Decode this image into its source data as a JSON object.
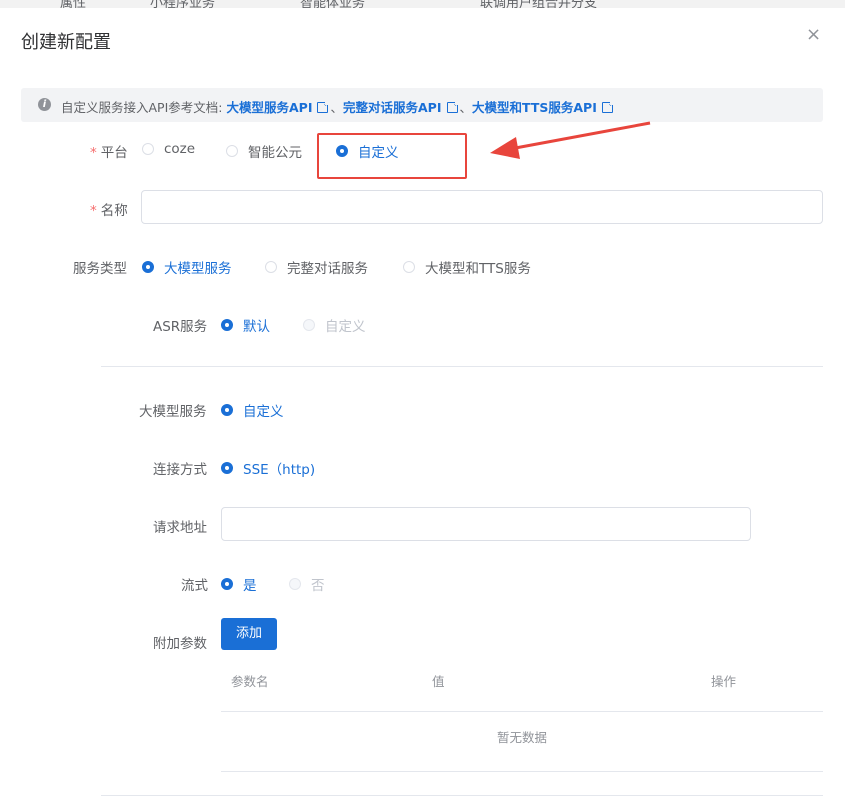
{
  "background_tabs": [
    "属性",
    "小程序业务",
    "智能体业务",
    "联调用户组合并分支"
  ],
  "dialog": {
    "title": "创建新配置",
    "close": "×"
  },
  "tip": {
    "text": "自定义服务接入API参考文档:",
    "links": [
      "大模型服务API",
      "完整对话服务API",
      "大模型和TTS服务API"
    ],
    "sep": "、"
  },
  "form": {
    "platform": {
      "label": "平台",
      "options": [
        "coze",
        "智能公元",
        "自定义"
      ],
      "selected": "自定义"
    },
    "name": {
      "label": "名称",
      "value": ""
    },
    "service_type": {
      "label": "服务类型",
      "options": [
        "大模型服务",
        "完整对话服务",
        "大模型和TTS服务"
      ],
      "selected": "大模型服务"
    },
    "asr": {
      "label": "ASR服务",
      "options": [
        "默认",
        "自定义"
      ],
      "selected": "默认"
    },
    "llm": {
      "label": "大模型服务",
      "options": [
        "自定义"
      ],
      "selected": "自定义"
    },
    "connection": {
      "label": "连接方式",
      "options": [
        "SSE（http)"
      ],
      "selected": "SSE（http)"
    },
    "url": {
      "label": "请求地址",
      "value": ""
    },
    "stream": {
      "label": "流式",
      "options": [
        "是",
        "否"
      ],
      "selected": "是"
    },
    "params": {
      "label": "附加参数",
      "add_button": "添加",
      "columns": [
        "参数名",
        "值",
        "操作"
      ],
      "empty": "暂无数据"
    }
  },
  "colors": {
    "primary": "#1a6fd6",
    "required": "#f56c6c",
    "annotation": "#e8453c"
  }
}
